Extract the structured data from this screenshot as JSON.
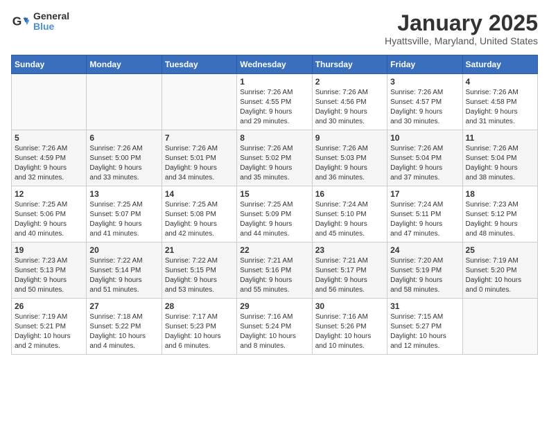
{
  "logo": {
    "line1": "General",
    "line2": "Blue"
  },
  "title": "January 2025",
  "subtitle": "Hyattsville, Maryland, United States",
  "days_of_week": [
    "Sunday",
    "Monday",
    "Tuesday",
    "Wednesday",
    "Thursday",
    "Friday",
    "Saturday"
  ],
  "weeks": [
    [
      {
        "day": "",
        "info": ""
      },
      {
        "day": "",
        "info": ""
      },
      {
        "day": "",
        "info": ""
      },
      {
        "day": "1",
        "info": "Sunrise: 7:26 AM\nSunset: 4:55 PM\nDaylight: 9 hours\nand 29 minutes."
      },
      {
        "day": "2",
        "info": "Sunrise: 7:26 AM\nSunset: 4:56 PM\nDaylight: 9 hours\nand 30 minutes."
      },
      {
        "day": "3",
        "info": "Sunrise: 7:26 AM\nSunset: 4:57 PM\nDaylight: 9 hours\nand 30 minutes."
      },
      {
        "day": "4",
        "info": "Sunrise: 7:26 AM\nSunset: 4:58 PM\nDaylight: 9 hours\nand 31 minutes."
      }
    ],
    [
      {
        "day": "5",
        "info": "Sunrise: 7:26 AM\nSunset: 4:59 PM\nDaylight: 9 hours\nand 32 minutes."
      },
      {
        "day": "6",
        "info": "Sunrise: 7:26 AM\nSunset: 5:00 PM\nDaylight: 9 hours\nand 33 minutes."
      },
      {
        "day": "7",
        "info": "Sunrise: 7:26 AM\nSunset: 5:01 PM\nDaylight: 9 hours\nand 34 minutes."
      },
      {
        "day": "8",
        "info": "Sunrise: 7:26 AM\nSunset: 5:02 PM\nDaylight: 9 hours\nand 35 minutes."
      },
      {
        "day": "9",
        "info": "Sunrise: 7:26 AM\nSunset: 5:03 PM\nDaylight: 9 hours\nand 36 minutes."
      },
      {
        "day": "10",
        "info": "Sunrise: 7:26 AM\nSunset: 5:04 PM\nDaylight: 9 hours\nand 37 minutes."
      },
      {
        "day": "11",
        "info": "Sunrise: 7:26 AM\nSunset: 5:04 PM\nDaylight: 9 hours\nand 38 minutes."
      }
    ],
    [
      {
        "day": "12",
        "info": "Sunrise: 7:25 AM\nSunset: 5:06 PM\nDaylight: 9 hours\nand 40 minutes."
      },
      {
        "day": "13",
        "info": "Sunrise: 7:25 AM\nSunset: 5:07 PM\nDaylight: 9 hours\nand 41 minutes."
      },
      {
        "day": "14",
        "info": "Sunrise: 7:25 AM\nSunset: 5:08 PM\nDaylight: 9 hours\nand 42 minutes."
      },
      {
        "day": "15",
        "info": "Sunrise: 7:25 AM\nSunset: 5:09 PM\nDaylight: 9 hours\nand 44 minutes."
      },
      {
        "day": "16",
        "info": "Sunrise: 7:24 AM\nSunset: 5:10 PM\nDaylight: 9 hours\nand 45 minutes."
      },
      {
        "day": "17",
        "info": "Sunrise: 7:24 AM\nSunset: 5:11 PM\nDaylight: 9 hours\nand 47 minutes."
      },
      {
        "day": "18",
        "info": "Sunrise: 7:23 AM\nSunset: 5:12 PM\nDaylight: 9 hours\nand 48 minutes."
      }
    ],
    [
      {
        "day": "19",
        "info": "Sunrise: 7:23 AM\nSunset: 5:13 PM\nDaylight: 9 hours\nand 50 minutes."
      },
      {
        "day": "20",
        "info": "Sunrise: 7:22 AM\nSunset: 5:14 PM\nDaylight: 9 hours\nand 51 minutes."
      },
      {
        "day": "21",
        "info": "Sunrise: 7:22 AM\nSunset: 5:15 PM\nDaylight: 9 hours\nand 53 minutes."
      },
      {
        "day": "22",
        "info": "Sunrise: 7:21 AM\nSunset: 5:16 PM\nDaylight: 9 hours\nand 55 minutes."
      },
      {
        "day": "23",
        "info": "Sunrise: 7:21 AM\nSunset: 5:17 PM\nDaylight: 9 hours\nand 56 minutes."
      },
      {
        "day": "24",
        "info": "Sunrise: 7:20 AM\nSunset: 5:19 PM\nDaylight: 9 hours\nand 58 minutes."
      },
      {
        "day": "25",
        "info": "Sunrise: 7:19 AM\nSunset: 5:20 PM\nDaylight: 10 hours\nand 0 minutes."
      }
    ],
    [
      {
        "day": "26",
        "info": "Sunrise: 7:19 AM\nSunset: 5:21 PM\nDaylight: 10 hours\nand 2 minutes."
      },
      {
        "day": "27",
        "info": "Sunrise: 7:18 AM\nSunset: 5:22 PM\nDaylight: 10 hours\nand 4 minutes."
      },
      {
        "day": "28",
        "info": "Sunrise: 7:17 AM\nSunset: 5:23 PM\nDaylight: 10 hours\nand 6 minutes."
      },
      {
        "day": "29",
        "info": "Sunrise: 7:16 AM\nSunset: 5:24 PM\nDaylight: 10 hours\nand 8 minutes."
      },
      {
        "day": "30",
        "info": "Sunrise: 7:16 AM\nSunset: 5:26 PM\nDaylight: 10 hours\nand 10 minutes."
      },
      {
        "day": "31",
        "info": "Sunrise: 7:15 AM\nSunset: 5:27 PM\nDaylight: 10 hours\nand 12 minutes."
      },
      {
        "day": "",
        "info": ""
      }
    ]
  ]
}
